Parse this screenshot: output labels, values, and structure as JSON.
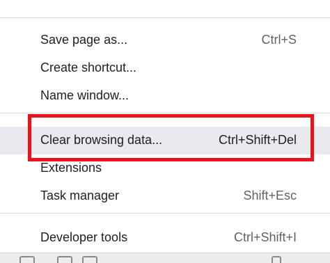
{
  "menu": {
    "items": [
      {
        "label": "Save page as...",
        "shortcut": "Ctrl+S"
      },
      {
        "label": "Create shortcut...",
        "shortcut": ""
      },
      {
        "label": "Name window...",
        "shortcut": ""
      },
      {
        "label": "Clear browsing data...",
        "shortcut": "Ctrl+Shift+Del",
        "highlighted": true
      },
      {
        "label": "Extensions",
        "shortcut": ""
      },
      {
        "label": "Task manager",
        "shortcut": "Shift+Esc"
      },
      {
        "label": "Developer tools",
        "shortcut": "Ctrl+Shift+I"
      }
    ]
  },
  "annotation": {
    "color": "#e8141b"
  },
  "colors": {
    "menu_background": "#ffffff",
    "highlight_background": "#e8eaed",
    "separator": "#dadce0",
    "text": "#202124"
  }
}
